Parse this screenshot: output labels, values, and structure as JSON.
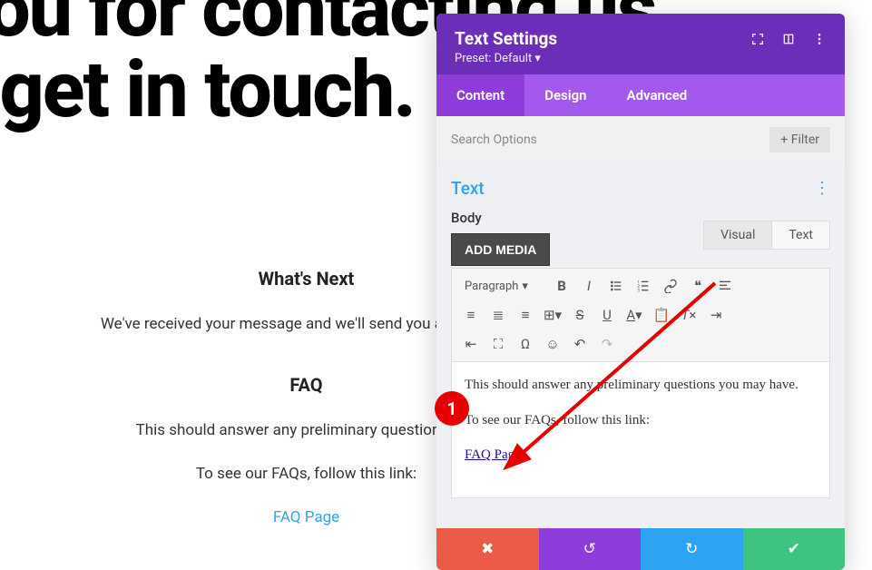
{
  "bg": {
    "heading_line1": "k you for contacting us.",
    "heading_line2": "e'll get in touch.",
    "whats_next_title": "What's Next",
    "whats_next_body": "We've received your message and we'll send you an email wi",
    "faq_title": "FAQ",
    "faq_body": "This should answer any preliminary questions you",
    "faq_followline": "To see our FAQs, follow this link:",
    "faq_page_link": "FAQ Page"
  },
  "modal": {
    "title": "Text Settings",
    "preset": "Preset: Default ▾",
    "tabs": {
      "content": "Content",
      "design": "Design",
      "advanced": "Advanced"
    },
    "search_placeholder": "Search Options",
    "filter_label": "Filter",
    "text_section_title": "Text",
    "body_label": "Body",
    "add_media": "ADD MEDIA",
    "editor_tabs": {
      "visual": "Visual",
      "text": "Text"
    },
    "toolbar": {
      "format": "Paragraph"
    },
    "editor": {
      "line1": "This should answer any preliminary questions you may have.",
      "line2": "To see our FAQs, follow this link:",
      "link_text": "FAQ Page"
    }
  },
  "annotation": {
    "marker": "1"
  }
}
